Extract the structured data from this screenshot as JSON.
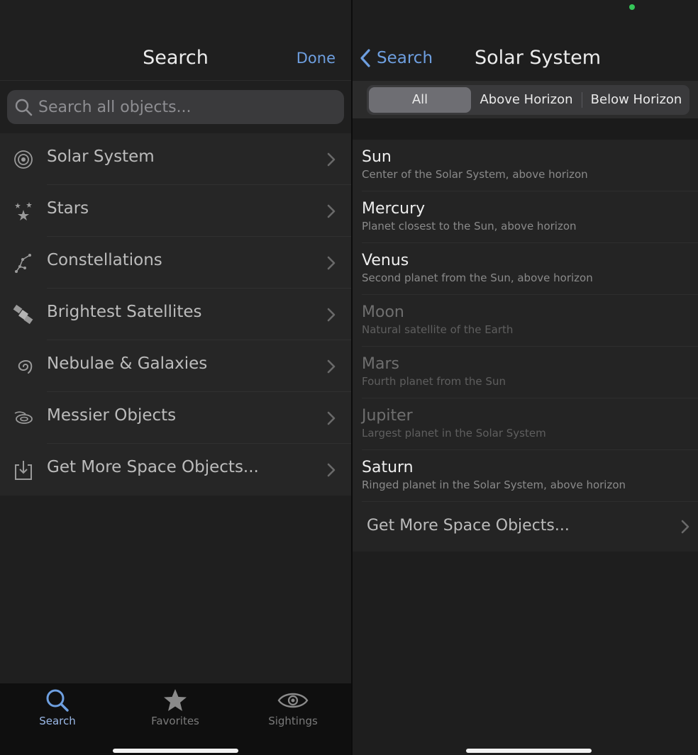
{
  "left": {
    "title": "Search",
    "done_label": "Done",
    "search_placeholder": "Search all objects...",
    "categories": [
      {
        "label": "Solar System",
        "icon": "solar-system-icon"
      },
      {
        "label": "Stars",
        "icon": "stars-icon"
      },
      {
        "label": "Constellations",
        "icon": "constellation-icon"
      },
      {
        "label": "Brightest Satellites",
        "icon": "satellite-icon"
      },
      {
        "label": "Nebulae & Galaxies",
        "icon": "galaxy-icon"
      },
      {
        "label": "Messier Objects",
        "icon": "messier-icon"
      },
      {
        "label": "Get More Space Objects...",
        "icon": "download-icon"
      }
    ]
  },
  "tabbar": {
    "tabs": [
      {
        "label": "Search",
        "icon": "search-icon",
        "active": true
      },
      {
        "label": "Favorites",
        "icon": "star-icon",
        "active": false
      },
      {
        "label": "Sightings",
        "icon": "eye-icon",
        "active": false
      }
    ]
  },
  "right": {
    "back_label": "Search",
    "title": "Solar System",
    "segments": [
      "All",
      "Above Horizon",
      "Below Horizon"
    ],
    "selected_segment": "All",
    "objects": [
      {
        "name": "Sun",
        "description": "Center of the Solar System, above horizon",
        "visible": true
      },
      {
        "name": "Mercury",
        "description": "Planet closest to the Sun, above horizon",
        "visible": true
      },
      {
        "name": "Venus",
        "description": "Second planet from the Sun, above horizon",
        "visible": true
      },
      {
        "name": "Moon",
        "description": "Natural satellite of the Earth",
        "visible": false
      },
      {
        "name": "Mars",
        "description": "Fourth planet from the Sun",
        "visible": false
      },
      {
        "name": "Jupiter",
        "description": "Largest planet in the Solar System",
        "visible": false
      },
      {
        "name": "Saturn",
        "description": "Ringed planet in the Solar System, above horizon",
        "visible": true
      }
    ],
    "more_label": "Get More Space Objects..."
  },
  "colors": {
    "accent": "#6e9fe0",
    "background": "#1f1f1f",
    "status_dot": "#35c759"
  }
}
